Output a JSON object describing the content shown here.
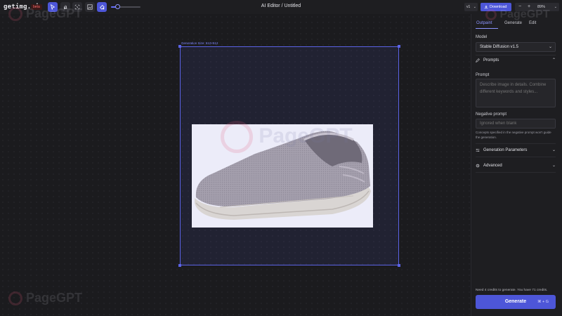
{
  "app": {
    "logo": "getimg.ai",
    "beta_badge": "beta",
    "title": "AI Editor / Untitled"
  },
  "toolbar": {
    "tools": [
      {
        "name": "select",
        "icon": "cursor-icon",
        "active": true
      },
      {
        "name": "pan",
        "icon": "hand-icon",
        "active": false
      },
      {
        "name": "crop",
        "icon": "crop-icon",
        "active": false
      },
      {
        "name": "image",
        "icon": "image-icon",
        "active": false
      },
      {
        "name": "eraser",
        "icon": "eraser-icon",
        "active": true
      }
    ],
    "brush_size_fraction": 0.22,
    "version_label": "v1",
    "download_label": "Download",
    "zoom_minus": "−",
    "zoom_plus": "+",
    "zoom_value": "89%"
  },
  "canvas": {
    "generation_label": "Generation Size: 512×512"
  },
  "watermark": "PageGPT",
  "panel": {
    "tabs": [
      {
        "label": "Outpaint",
        "active": true
      },
      {
        "label": "Generate",
        "active": false
      },
      {
        "label": "Edit",
        "active": false
      }
    ],
    "model_label": "Model",
    "model_value": "Stable Diffusion v1.5",
    "prompts_section": "Prompts",
    "prompt_label": "Prompt",
    "prompt_placeholder": "Describe image in details. Combine different keywords and styles...",
    "negative_label": "Negative prompt",
    "negative_placeholder": "Ignored when blank",
    "negative_hint": "Concepts specified in the negative prompt won't guide the generation.",
    "gen_params_section": "Generation Parameters",
    "advanced_section": "Advanced",
    "credits_text": "Need 4 credits to generate. You have 71 credits.",
    "generate_label": "Generate",
    "generate_shortcut": "⌘ + G"
  },
  "colors": {
    "accent": "#4d56d8",
    "background": "#1c1c1f",
    "frame": "#5b63e6"
  }
}
